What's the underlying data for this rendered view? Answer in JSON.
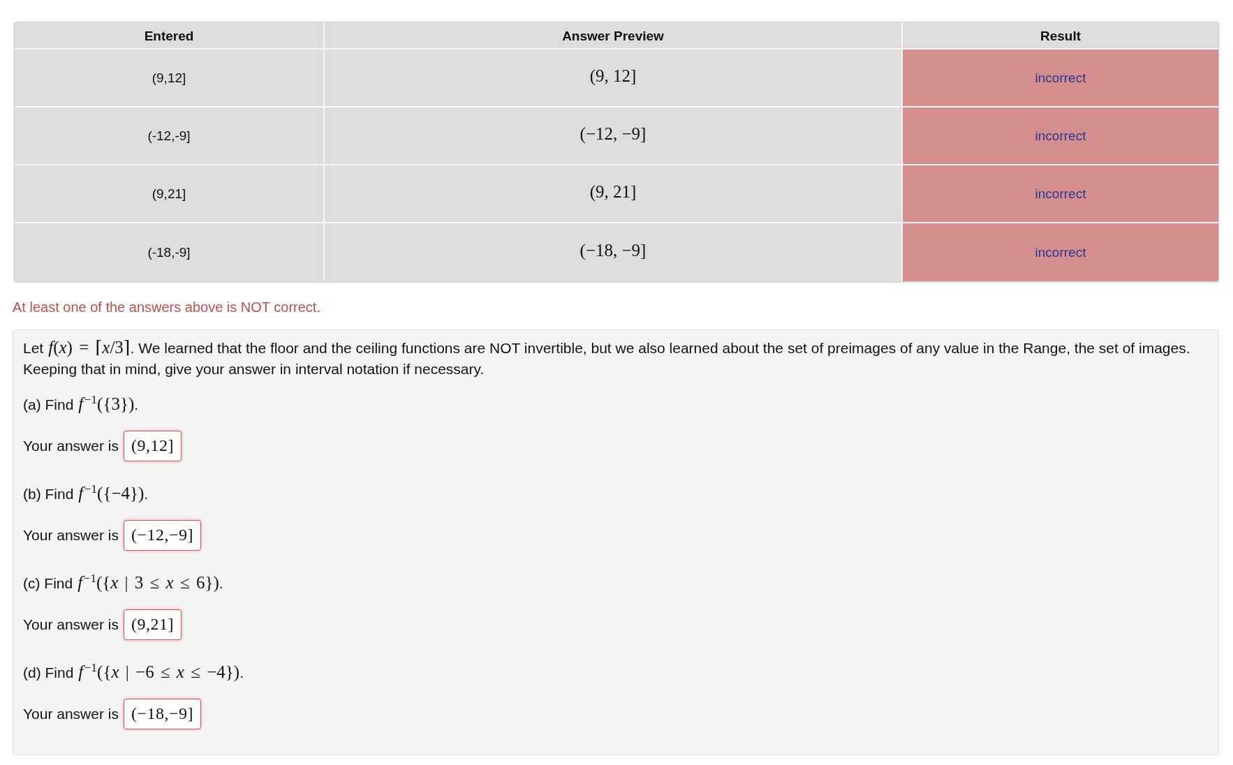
{
  "results_table": {
    "columns": [
      "Entered",
      "Answer Preview",
      "Result"
    ],
    "rows": [
      {
        "entered": "(9,12]",
        "preview": "(9, 12]",
        "result": "incorrect",
        "correct": false
      },
      {
        "entered": "(-12,-9]",
        "preview": "(−12, −9]",
        "result": "incorrect",
        "correct": false
      },
      {
        "entered": "(9,21]",
        "preview": "(9, 21]",
        "result": "incorrect",
        "correct": false
      },
      {
        "entered": "(-18,-9]",
        "preview": "(−18, −9]",
        "result": "incorrect",
        "correct": false
      }
    ]
  },
  "feedback_message": "At least one of the answers above is NOT correct.",
  "problem": {
    "statement": {
      "before": "Let",
      "math": "*f*(*x*) = ⌈*x*/3⌉",
      "after": ". We learned that the floor and the ceiling functions are NOT invertible, but we also learned about the set of preimages of any value in the Range, the set of images. Keeping that in mind, give your answer in interval notation if necessary."
    },
    "parts": [
      {
        "label": "(a) Find",
        "math": "*f*$^{−1}$({3})",
        "end": ".",
        "answer_label": "Your answer is",
        "answer": "(9,12]",
        "correct": false
      },
      {
        "label": "(b) Find",
        "math": "*f*$^{−1}$({−4})",
        "end": ".",
        "answer_label": "Your answer is",
        "answer": "(−12,−9]",
        "correct": false
      },
      {
        "label": "(c) Find",
        "math": "*f*$^{−1}$({*x* | 3 ≤ *x* ≤ 6})",
        "end": ".",
        "answer_label": "Your answer is",
        "answer": "(9,21]",
        "correct": false
      },
      {
        "label": "(d) Find",
        "math": "*f*$^{−1}$({*x* | −6 ≤ *x* ≤ −4})",
        "end": ".",
        "answer_label": "Your answer is",
        "answer": "(−18,−9]",
        "correct": false
      }
    ]
  }
}
